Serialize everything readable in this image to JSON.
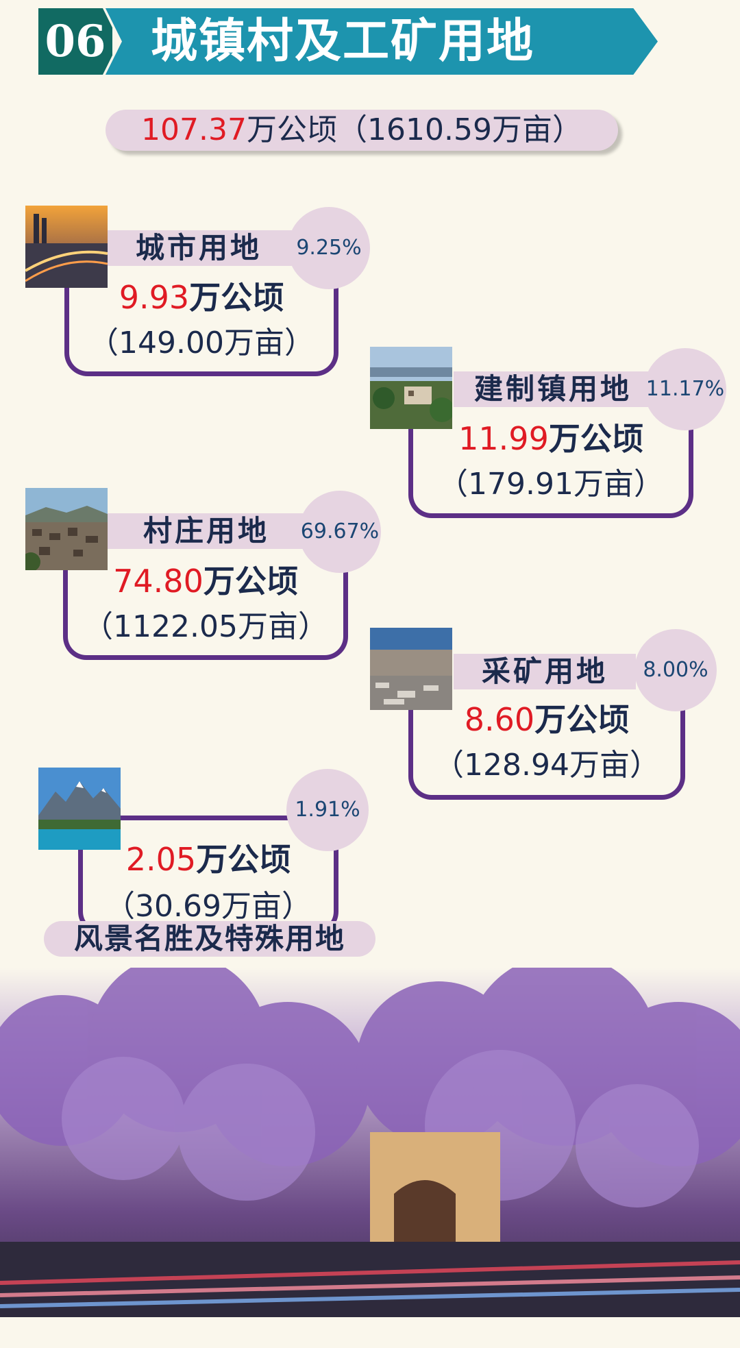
{
  "header": {
    "number": "06",
    "title": "城镇村及工矿用地"
  },
  "total": {
    "hectare_value": "107.37",
    "hectare_unit": "万公顷",
    "mu_text": "（1610.59万亩）"
  },
  "cards": [
    {
      "name": "城市用地",
      "percent": "9.25%",
      "hectare_value": "9.93",
      "hectare_unit": "万公顷",
      "mu_text": "（149.00万亩）",
      "photo_icon": "city-highway-photo"
    },
    {
      "name": "建制镇用地",
      "percent": "11.17%",
      "hectare_value": "11.99",
      "hectare_unit": "万公顷",
      "mu_text": "（179.91万亩）",
      "photo_icon": "town-photo"
    },
    {
      "name": "村庄用地",
      "percent": "69.67%",
      "hectare_value": "74.80",
      "hectare_unit": "万公顷",
      "mu_text": "（1122.05万亩）",
      "photo_icon": "village-photo"
    },
    {
      "name": "采矿用地",
      "percent": "8.00%",
      "hectare_value": "8.60",
      "hectare_unit": "万公顷",
      "mu_text": "（128.94万亩）",
      "photo_icon": "quarry-photo"
    },
    {
      "name": "风景名胜及特殊用地",
      "percent": "1.91%",
      "hectare_value": "2.05",
      "hectare_unit": "万公顷",
      "mu_text": "（30.69万亩）",
      "photo_icon": "mountain-lake-photo"
    }
  ],
  "banner": {
    "photo_icon": "jacaranda-street-photo"
  },
  "colors": {
    "accent_red": "#e01b24",
    "frame_purple": "#5c2f86",
    "pill": "#e6d4e1",
    "header_teal": "#1d94ae",
    "header_dark": "#116a62",
    "background": "#faf7ec"
  }
}
